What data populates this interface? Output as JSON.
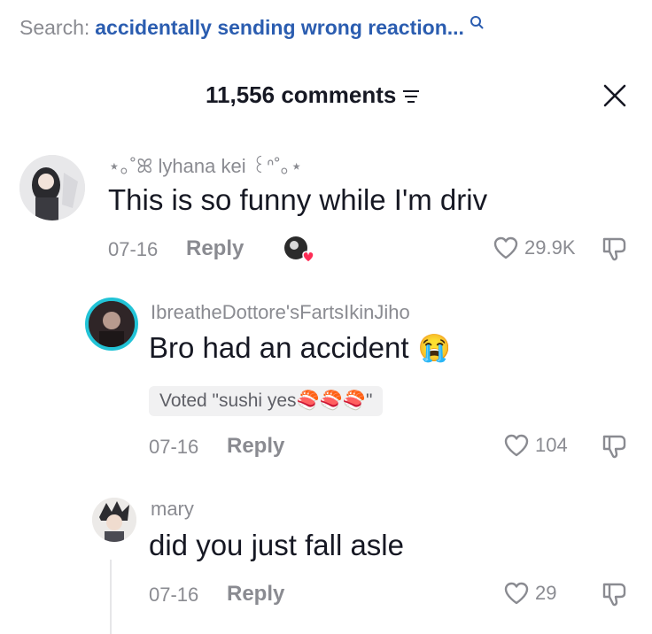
{
  "search": {
    "prefix": "Search:",
    "query": "accidentally sending wrong reaction...",
    "icon": "search-icon"
  },
  "header": {
    "count_label": "11,556 comments",
    "filter_icon": "filter-icon",
    "close_icon": "close-icon"
  },
  "comments": [
    {
      "username": "⋆｡˚ꕤ lyhana kei ꒰ᐢ˚｡⋆",
      "text": "This is so funny while I'm driv",
      "date": "07-16",
      "reply_label": "Reply",
      "likes": "29.9K",
      "liked_by_creator": true
    },
    {
      "username": "IbreatheDottore'sFartsIkinJiho",
      "text": "Bro had an accident",
      "emoji": "😭",
      "vote": "Voted \"sushi yes🍣🍣🍣\"",
      "date": "07-16",
      "reply_label": "Reply",
      "likes": "104"
    },
    {
      "username": "mary",
      "text": "did you just fall asle",
      "date": "07-16",
      "reply_label": "Reply",
      "likes": "29"
    }
  ],
  "colors": {
    "accent_query": "#2b5db0",
    "muted": "#8a8b91",
    "story_ring": "#22c3d6",
    "creator_heart": "#fe2c55"
  }
}
